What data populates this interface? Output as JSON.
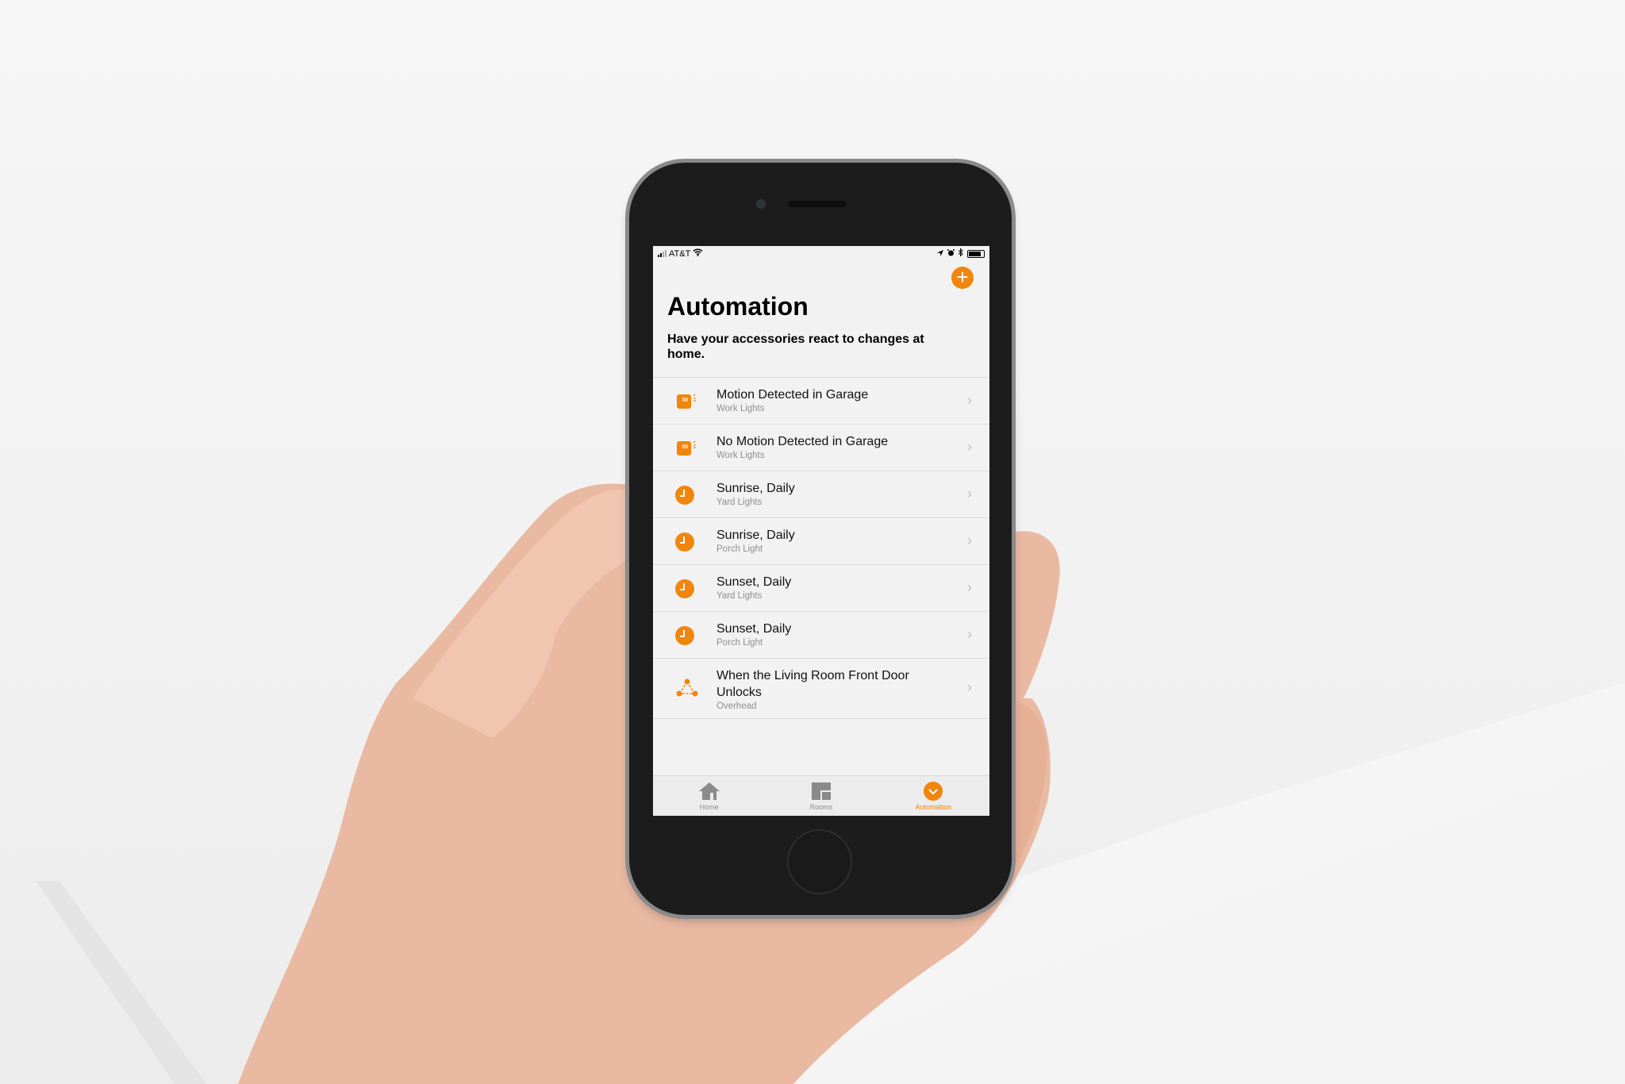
{
  "status_bar": {
    "carrier": "AT&T",
    "icons": [
      "signal-icon",
      "wifi-icon",
      "location-icon",
      "alarm-icon",
      "bluetooth-icon",
      "battery-icon"
    ]
  },
  "header": {
    "add_button": "+",
    "title": "Automation",
    "subtitle": "Have your accessories react to changes at home."
  },
  "accent_color": "#F0860E",
  "automations": [
    {
      "icon": "motion-sensor-icon",
      "name": "Motion Detected in Garage",
      "accessory": "Work Lights"
    },
    {
      "icon": "motion-sensor-icon",
      "name": "No Motion Detected in Garage",
      "accessory": "Work Lights"
    },
    {
      "icon": "clock-icon",
      "name": "Sunrise, Daily",
      "accessory": "Yard Lights"
    },
    {
      "icon": "clock-icon",
      "name": "Sunrise, Daily",
      "accessory": "Porch Light"
    },
    {
      "icon": "clock-icon",
      "name": "Sunset, Daily",
      "accessory": "Yard Lights"
    },
    {
      "icon": "clock-icon",
      "name": "Sunset, Daily",
      "accessory": "Porch Light"
    },
    {
      "icon": "network-icon",
      "name": "When the Living Room Front Door Unlocks",
      "accessory": "Overhead"
    }
  ],
  "tabs": [
    {
      "label": "Home",
      "icon": "house-icon",
      "active": false
    },
    {
      "label": "Rooms",
      "icon": "rooms-icon",
      "active": false
    },
    {
      "label": "Automation",
      "icon": "automation-icon",
      "active": true
    }
  ]
}
